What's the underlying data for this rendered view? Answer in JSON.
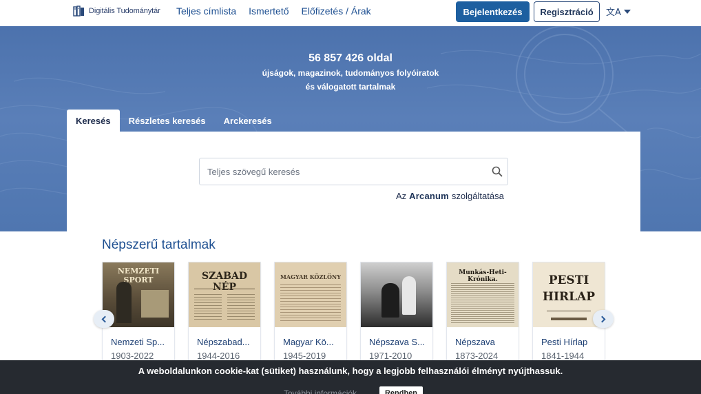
{
  "navbar": {
    "logo_text": "Digitális Tudománytár",
    "links": [
      "Teljes címlista",
      "Ismertető",
      "Előfizetés / Árak"
    ],
    "login_label": "Bejelentkezés",
    "register_label": "Regisztráció",
    "language_icon": "translate-icon",
    "accent_color": "#1d5fa0"
  },
  "hero": {
    "count": "56 857 426 oldal",
    "line1": "újságok, magazinok, tudományos folyóiratok",
    "line2": "és válogatott tartalmak",
    "background_color": "#5a7fb8"
  },
  "tabs": [
    {
      "label": "Keresés",
      "active": true
    },
    {
      "label": "Részletes keresés",
      "active": false
    },
    {
      "label": "Arckeresés",
      "active": false
    }
  ],
  "search": {
    "placeholder": "Teljes szövegű keresés",
    "value": "",
    "icon": "search-icon",
    "service_prefix": "Az",
    "service_brand": "Arcanum",
    "service_suffix": "szolgáltatása"
  },
  "popular": {
    "title": "Népszerű tartalmak",
    "items": [
      {
        "name": "Nemzeti Sp...",
        "years": "1903-2022",
        "masthead": "NEMZETI SPORT"
      },
      {
        "name": "Népszabad...",
        "years": "1944-2016",
        "masthead": "SZABAD NÉP"
      },
      {
        "name": "Magyar Kö...",
        "years": "1945-2019",
        "masthead": "MAGYAR KÖZLÖNY"
      },
      {
        "name": "Népszava S...",
        "years": "1971-2010",
        "masthead": ""
      },
      {
        "name": "Népszava",
        "years": "1873-2024",
        "masthead": "Munkás-Heti-Krónika."
      },
      {
        "name": "Pesti Hírlap",
        "years": "1841-1944",
        "masthead": "PESTI HIRLAP"
      }
    ],
    "prev_icon": "chevron-left-icon",
    "next_icon": "chevron-right-icon"
  },
  "cookie": {
    "message": "A weboldalunkon cookie-kat (sütiket) használunk, hogy a legjobb felhasználói élményt nyújthassuk.",
    "more_label": "További információk",
    "ok_label": "Rendben"
  }
}
